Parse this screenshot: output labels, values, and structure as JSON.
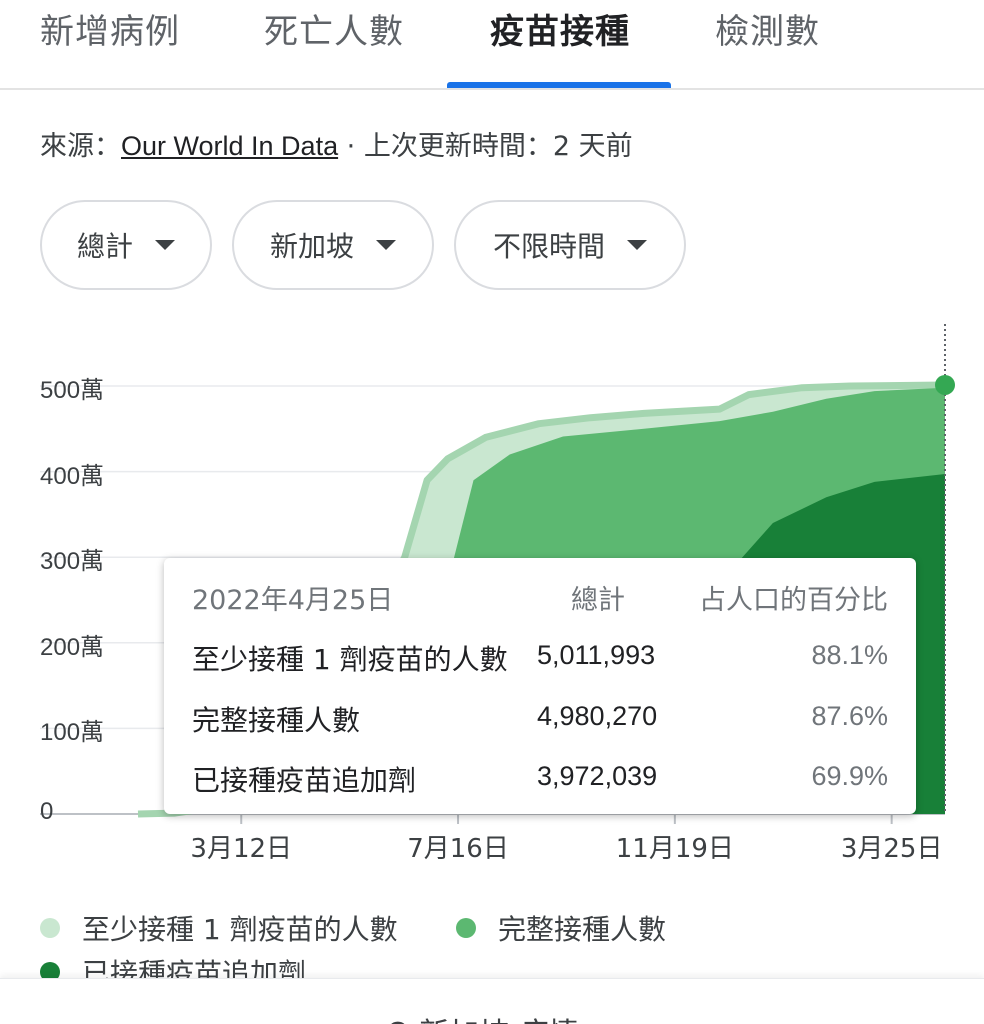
{
  "tabs": [
    {
      "label": "新增病例",
      "active": false
    },
    {
      "label": "死亡人數",
      "active": false
    },
    {
      "label": "疫苗接種",
      "active": true
    },
    {
      "label": "檢測數",
      "active": false
    }
  ],
  "source": {
    "prefix": "來源：",
    "link": "Our World In Data",
    "suffix": " · 上次更新時間：2 天前"
  },
  "filters": {
    "metric": "總計",
    "region": "新加坡",
    "range": "不限時間"
  },
  "chart_data": {
    "type": "area",
    "y_tick_labels": [
      "0",
      "100萬",
      "200萬",
      "300萬",
      "400萬",
      "500萬"
    ],
    "ylim": [
      0,
      5000000
    ],
    "x_tick_labels": [
      "3月12日",
      "7月16日",
      "11月19日",
      "3月25日"
    ],
    "x_tick_dates": [
      "2021-03-12",
      "2021-07-16",
      "2021-11-19",
      "2022-03-25"
    ],
    "xlim": [
      "2021-01-11",
      "2022-04-25"
    ],
    "grid": true,
    "legend_position": "bottom",
    "series": [
      {
        "name": "至少接種 1 劑疫苗的人數",
        "color": "#c9e7d0",
        "edge_color": "#a4d5b0",
        "points": [
          [
            "2021-01-11",
            0
          ],
          [
            "2021-02-01",
            10000
          ],
          [
            "2021-03-12",
            120000
          ],
          [
            "2021-04-10",
            600000
          ],
          [
            "2021-05-15",
            1800000
          ],
          [
            "2021-06-15",
            3000000
          ],
          [
            "2021-06-28",
            3900000
          ],
          [
            "2021-07-10",
            4150000
          ],
          [
            "2021-08-01",
            4400000
          ],
          [
            "2021-09-01",
            4560000
          ],
          [
            "2021-10-01",
            4630000
          ],
          [
            "2021-11-01",
            4680000
          ],
          [
            "2021-12-15",
            4730000
          ],
          [
            "2022-01-01",
            4900000
          ],
          [
            "2022-02-01",
            4980000
          ],
          [
            "2022-03-01",
            5000000
          ],
          [
            "2022-04-25",
            5011993
          ]
        ]
      },
      {
        "name": "完整接種人數",
        "color": "#5cb871",
        "points": [
          [
            "2021-01-11",
            0
          ],
          [
            "2021-02-15",
            0
          ],
          [
            "2021-03-12",
            30000
          ],
          [
            "2021-05-01",
            300000
          ],
          [
            "2021-06-15",
            1500000
          ],
          [
            "2021-07-10",
            2700000
          ],
          [
            "2021-07-25",
            3900000
          ],
          [
            "2021-08-15",
            4200000
          ],
          [
            "2021-09-15",
            4410000
          ],
          [
            "2021-11-01",
            4500000
          ],
          [
            "2021-12-15",
            4590000
          ],
          [
            "2022-01-15",
            4700000
          ],
          [
            "2022-02-15",
            4850000
          ],
          [
            "2022-03-15",
            4940000
          ],
          [
            "2022-04-25",
            4980270
          ]
        ]
      },
      {
        "name": "已接種疫苗追加劑",
        "color": "#188038",
        "points": [
          [
            "2021-01-11",
            0
          ],
          [
            "2021-09-01",
            0
          ],
          [
            "2021-10-01",
            300000
          ],
          [
            "2021-11-15",
            1600000
          ],
          [
            "2021-12-15",
            2700000
          ],
          [
            "2022-01-15",
            3400000
          ],
          [
            "2022-02-15",
            3700000
          ],
          [
            "2022-03-15",
            3880000
          ],
          [
            "2022-04-25",
            3972039
          ]
        ]
      }
    ],
    "highlight": {
      "date_label": "2022年4月25日",
      "col_total": "總計",
      "col_percent": "占人口的百分比",
      "rows": [
        {
          "name": "至少接種 1 劑疫苗的人數",
          "value": "5,011,993",
          "percent": "88.1%"
        },
        {
          "name": "完整接種人數",
          "value": "4,980,270",
          "percent": "87.6%"
        },
        {
          "name": "已接種疫苗追加劑",
          "value": "3,972,039",
          "percent": "69.9%"
        }
      ]
    }
  },
  "legend": [
    {
      "label": "至少接種 1 劑疫苗的人數",
      "color": "#c9e7d0"
    },
    {
      "label": "完整接種人數",
      "color": "#5cb871"
    },
    {
      "label": "已接種疫苗追加劑",
      "color": "#188038"
    }
  ],
  "bottom_bar": {
    "label": "Q 新加坡 疫情"
  }
}
